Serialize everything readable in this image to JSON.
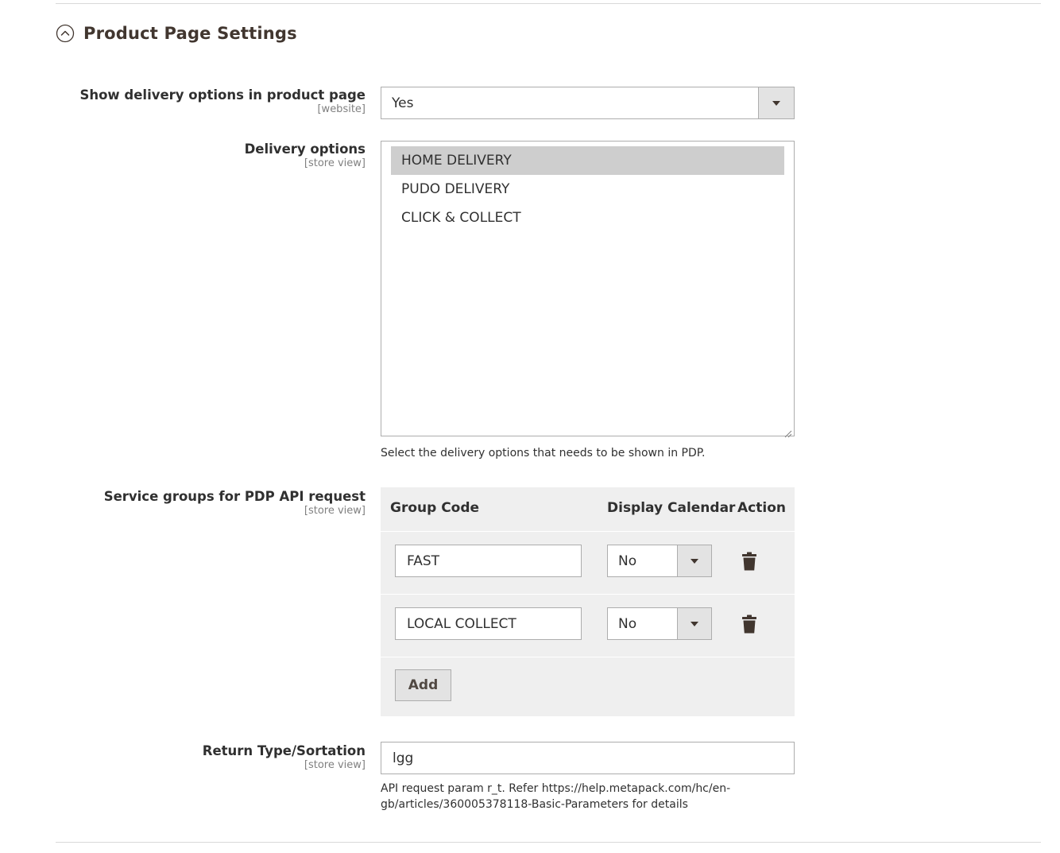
{
  "section": {
    "title": "Product Page Settings"
  },
  "fields": {
    "show_delivery": {
      "label": "Show delivery options in product page",
      "scope": "[website]",
      "value": "Yes"
    },
    "delivery_options": {
      "label": "Delivery options",
      "scope": "[store view]",
      "options": [
        "HOME DELIVERY",
        "PUDO DELIVERY",
        "CLICK & COLLECT"
      ],
      "selected": "HOME DELIVERY",
      "note": "Select the delivery options that needs to be shown in PDP."
    },
    "service_groups": {
      "label": "Service groups for PDP API request",
      "scope": "[store view]",
      "columns": [
        "Group Code",
        "Display Calendar",
        "Action"
      ],
      "rows": [
        {
          "group_code": "FAST",
          "display_calendar": "No"
        },
        {
          "group_code": "LOCAL COLLECT",
          "display_calendar": "No"
        }
      ],
      "add_label": "Add"
    },
    "return_type": {
      "label": "Return Type/Sortation",
      "scope": "[store view]",
      "value": "lgg",
      "note_line1": "API request param r_t. Refer https://help.metapack.com/hc/en-",
      "note_line2": "gb/articles/360005378118-Basic-Parameters for details"
    }
  },
  "icons": {
    "collapse": "chevron-up-circle-icon",
    "dropdown": "triangle-down-icon",
    "delete": "trash-icon"
  },
  "colors": {
    "title": "#41362f",
    "border": "#adadad",
    "grid_bg": "#efefef",
    "selected_option": "#cecece"
  }
}
